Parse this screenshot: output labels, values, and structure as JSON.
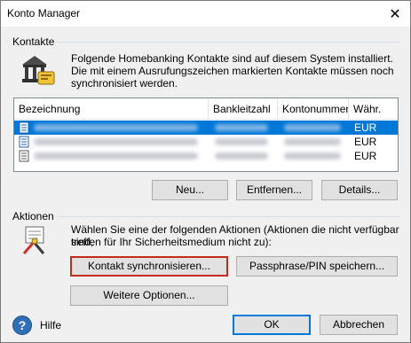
{
  "window": {
    "title": "Konto Manager",
    "close_glyph": "✕"
  },
  "contacts": {
    "group_label": "Kontakte",
    "info_line1": "Folgende Homebanking Kontakte sind auf diesem System installiert.",
    "info_line2": "Die mit einem Ausrufungszeichen markierten Kontakte müssen noch",
    "info_line3": "synchronisiert werden.",
    "icon": "bank-building-icon",
    "list": {
      "columns": [
        "Bezeichnung",
        "Bankleitzahl",
        "Kontonummer",
        "Währ."
      ],
      "rows": [
        {
          "currency": "EUR",
          "selected": true
        },
        {
          "currency": "EUR",
          "selected": false
        },
        {
          "currency": "EUR",
          "selected": false
        }
      ]
    },
    "buttons": {
      "new": "Neu...",
      "remove": "Entfernen...",
      "details": "Details..."
    }
  },
  "actions": {
    "group_label": "Aktionen",
    "info_line1": "Wählen Sie eine der folgenden Aktionen (Aktionen die nicht verfügbar sind,",
    "info_line2": "treffen für Ihr Sicherheitsmedium nicht zu):",
    "icon": "tools-document-icon",
    "buttons": {
      "sync": "Kontakt synchronisieren...",
      "passphrase": "Passphrase/PIN speichern...",
      "more": "Weitere Optionen..."
    }
  },
  "footer": {
    "help_label": "Hilfe",
    "help_glyph": "?",
    "ok": "OK",
    "cancel": "Abbrechen"
  },
  "colors": {
    "selection": "#0078d7",
    "highlight_border": "#c42b1c",
    "focus_border": "#0078d7"
  }
}
